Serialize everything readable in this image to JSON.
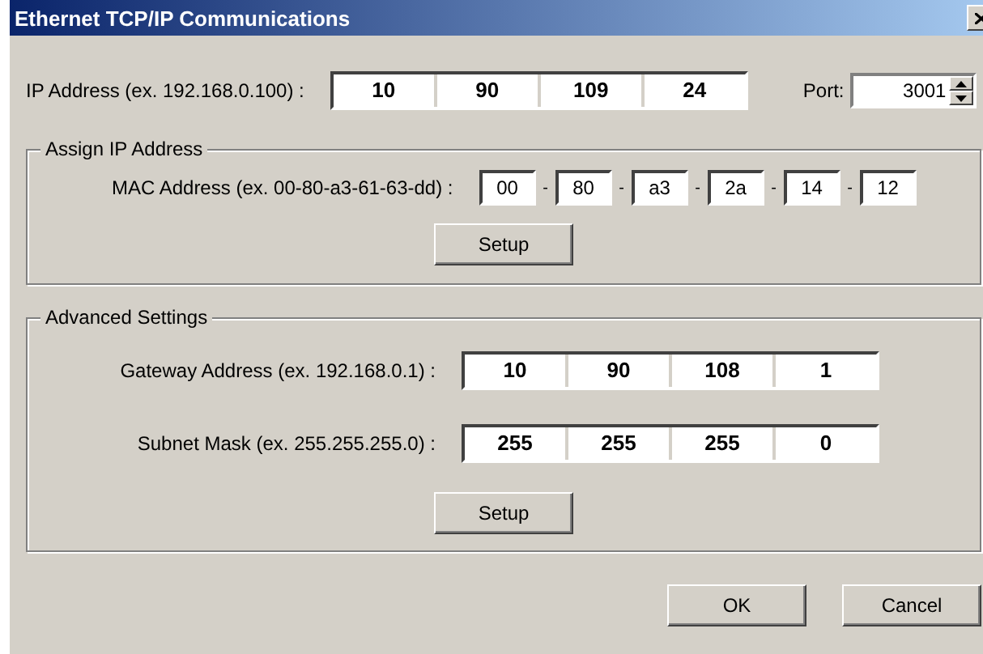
{
  "window": {
    "title": "Ethernet TCP/IP Communications"
  },
  "ip_address": {
    "label": "IP Address (ex. 192.168.0.100) :",
    "octets": [
      "10",
      "90",
      "109",
      "24"
    ]
  },
  "port": {
    "label": "Port:",
    "value": "3001"
  },
  "assign_ip": {
    "title": "Assign IP Address",
    "mac_label": "MAC Address  (ex. 00-80-a3-61-63-dd) :",
    "mac_octets": [
      "00",
      "80",
      "a3",
      "2a",
      "14",
      "12"
    ],
    "separators": [
      "-",
      "-",
      "-",
      "-",
      "-"
    ],
    "setup_button": "Setup"
  },
  "advanced": {
    "title": "Advanced Settings",
    "gateway": {
      "label": "Gateway Address (ex. 192.168.0.1) :",
      "octets": [
        "10",
        "90",
        "108",
        "1"
      ]
    },
    "subnet": {
      "label": "Subnet Mask (ex. 255.255.255.0) :",
      "octets": [
        "255",
        "255",
        "255",
        "0"
      ]
    },
    "setup_button": "Setup"
  },
  "buttons": [
    "OK",
    "Cancel"
  ]
}
